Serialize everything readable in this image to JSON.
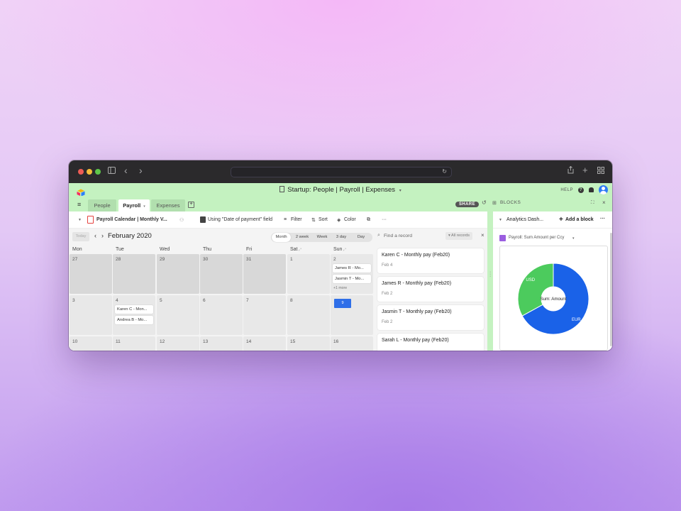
{
  "browser": {
    "nav_back": "‹",
    "nav_forward": "›",
    "url": "",
    "icons": [
      "sidebar-icon",
      "back-icon",
      "forward-icon",
      "reload-icon",
      "share-icon",
      "new-tab-icon",
      "tab-overview-icon"
    ]
  },
  "app": {
    "title": "Startup: People | Payroll | Expenses",
    "title_caret": "▾",
    "help_label": "HELP",
    "help_icon": "?",
    "accent_color": "#c4f2c0"
  },
  "tabs": [
    {
      "label": "People",
      "active": false
    },
    {
      "label": "Payroll",
      "active": true,
      "caret": "▾"
    },
    {
      "label": "Expenses",
      "active": false
    }
  ],
  "tabbar_right": {
    "share_label": "SHARE",
    "blocks_label": "BLOCKS"
  },
  "toolbar": {
    "view_name": "Payroll Calendar | Monthly V...",
    "date_field": "Using \"Date of payment\" field",
    "filter": "Filter",
    "sort": "Sort",
    "color": "Color",
    "more": "···"
  },
  "calendar": {
    "today_label": "Today",
    "prev": "‹",
    "next": "›",
    "month_label": "February 2020",
    "modes": [
      {
        "label": "Month",
        "active": true
      },
      {
        "label": "2 week",
        "active": false
      },
      {
        "label": "Week",
        "active": false
      },
      {
        "label": "3 day",
        "active": false
      },
      {
        "label": "Day",
        "active": false
      }
    ],
    "weekdays": [
      "Mon",
      "Tue",
      "Wed",
      "Thu",
      "Fri",
      "Sat",
      "Sun"
    ],
    "weeks": [
      [
        {
          "day": "27",
          "past": true,
          "events": []
        },
        {
          "day": "28",
          "past": true,
          "events": []
        },
        {
          "day": "29",
          "past": true,
          "events": []
        },
        {
          "day": "30",
          "past": true,
          "events": []
        },
        {
          "day": "31",
          "past": true,
          "events": []
        },
        {
          "day": "1",
          "past": false,
          "events": []
        },
        {
          "day": "2",
          "past": false,
          "events": [
            "James R - Mo...",
            "Jasmin T - Mo..."
          ],
          "more": "+1 more"
        }
      ],
      [
        {
          "day": "3",
          "past": false,
          "events": []
        },
        {
          "day": "4",
          "past": false,
          "events": [
            "Karen C - Mon...",
            "Andrea B - Mo..."
          ]
        },
        {
          "day": "5",
          "past": false,
          "events": []
        },
        {
          "day": "6",
          "past": false,
          "events": []
        },
        {
          "day": "7",
          "past": false,
          "events": []
        },
        {
          "day": "8",
          "past": false,
          "events": []
        },
        {
          "day": "9",
          "past": false,
          "today": true,
          "events": []
        }
      ],
      [
        {
          "day": "10",
          "past": false,
          "events": []
        },
        {
          "day": "11",
          "past": false,
          "events": []
        },
        {
          "day": "12",
          "past": false,
          "events": []
        },
        {
          "day": "13",
          "past": false,
          "events": []
        },
        {
          "day": "14",
          "past": false,
          "events": []
        },
        {
          "day": "15",
          "past": false,
          "events": []
        },
        {
          "day": "16",
          "past": false,
          "events": []
        }
      ]
    ],
    "today_color": "#2f6fe8"
  },
  "records": {
    "search_placeholder": "Find a record",
    "filter_label": "All records",
    "close": "×",
    "items": [
      {
        "title": "Karen C - Monthly pay (Feb20)",
        "date": "Feb 4"
      },
      {
        "title": "James R - Monthly pay (Feb20)",
        "date": "Feb 2"
      },
      {
        "title": "Jasmin T - Monthly pay (Feb20)",
        "date": "Feb 2"
      },
      {
        "title": "Sarah L - Monthly pay (Feb20)",
        "date": ""
      }
    ]
  },
  "panel": {
    "title": "Analytics Dash...",
    "add_block": "Add a block",
    "more": "···",
    "block_title": "Payroll: Sum Amount per Ccy",
    "block_caret": "▾"
  },
  "chart_data": {
    "type": "pie",
    "donut": true,
    "center_label": "Sum: Amount",
    "categories": [
      "EUR",
      "USD"
    ],
    "values": [
      67,
      33
    ],
    "unit": "percent (estimated)",
    "colors": [
      "#1a62e8",
      "#4ccb5d"
    ],
    "start_angle": "12 o'clock, clockwise",
    "legend": "labels on slices"
  }
}
